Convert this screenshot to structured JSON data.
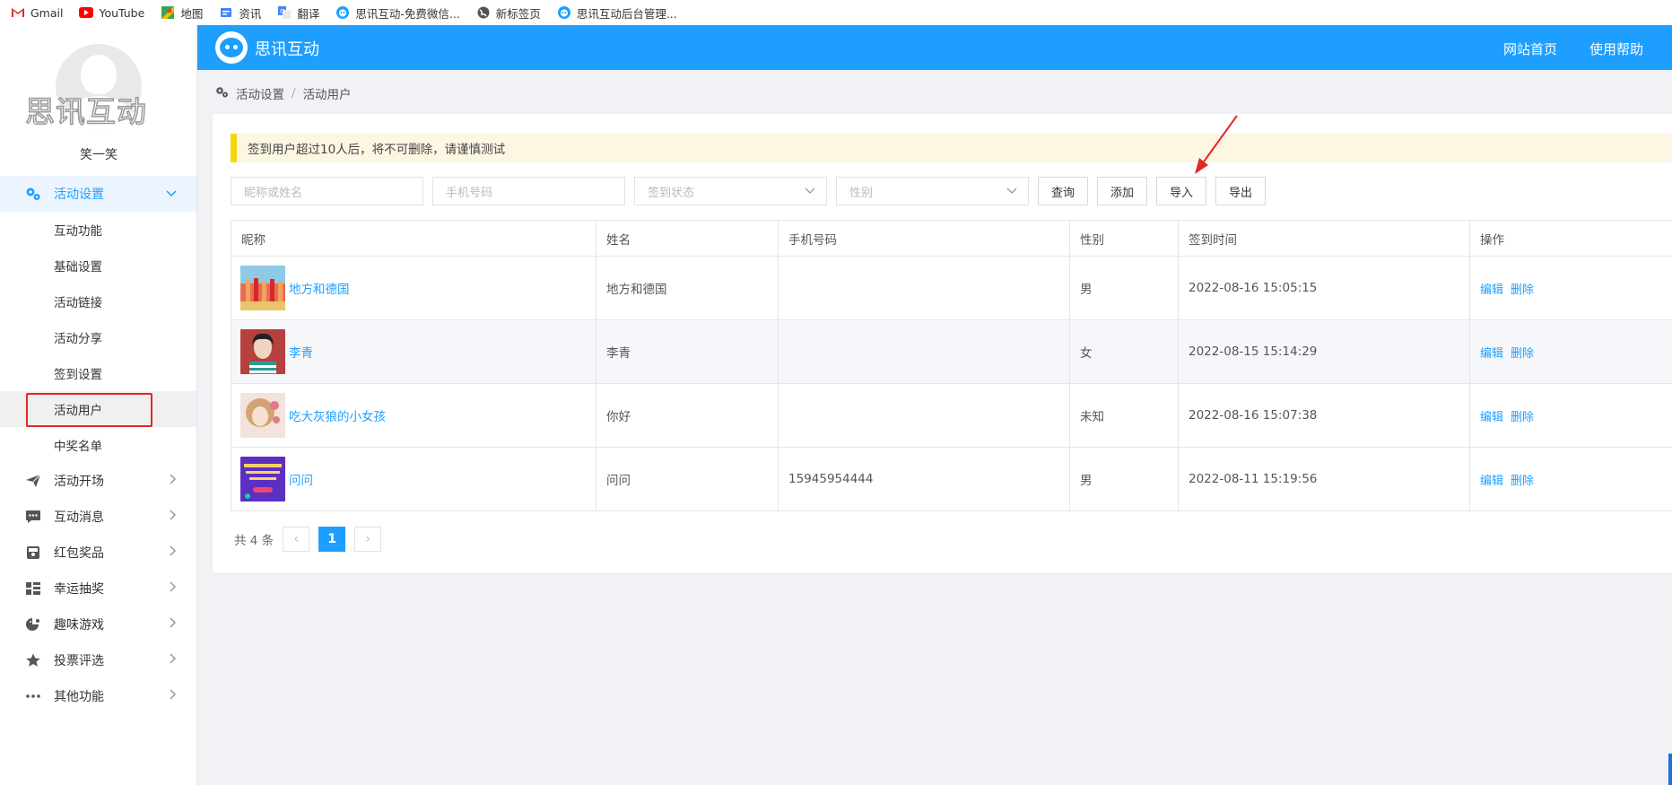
{
  "bookmarks": [
    {
      "label": "Gmail",
      "icon": "gmail-icon",
      "color": "#d93025"
    },
    {
      "label": "YouTube",
      "icon": "youtube-icon",
      "color": "#ff0000"
    },
    {
      "label": "地图",
      "icon": "maps-icon",
      "color": "#34a853"
    },
    {
      "label": "资讯",
      "icon": "news-icon",
      "color": "#4285f4"
    },
    {
      "label": "翻译",
      "icon": "translate-icon",
      "color": "#4285f4"
    },
    {
      "label": "思讯互动-免费微信...",
      "icon": "sixun-icon",
      "color": "#1e9fff"
    },
    {
      "label": "新标签页",
      "icon": "globe-icon",
      "color": "#555555"
    },
    {
      "label": "思讯互动后台管理...",
      "icon": "sixun-icon",
      "color": "#1e9fff"
    }
  ],
  "sidebar": {
    "avatar_watermark": "思讯互动",
    "username": "笑一笑",
    "menu_open": {
      "label": "活动设置",
      "icon": "gear-icon"
    },
    "sub_items": [
      "互动功能",
      "基础设置",
      "活动链接",
      "活动分享",
      "签到设置",
      "活动用户",
      "中奖名单"
    ],
    "menu_rest": [
      {
        "label": "活动开场",
        "icon": "paper-plane-icon"
      },
      {
        "label": "互动消息",
        "icon": "chat-icon"
      },
      {
        "label": "红包奖品",
        "icon": "gift-icon"
      },
      {
        "label": "幸运抽奖",
        "icon": "lottery-icon"
      },
      {
        "label": "趣味游戏",
        "icon": "game-icon"
      },
      {
        "label": "投票评选",
        "icon": "star-icon"
      },
      {
        "label": "其他功能",
        "icon": "more-icon"
      }
    ]
  },
  "header": {
    "brand": "思讯互动",
    "link_home": "网站首页",
    "link_help": "使用帮助",
    "bg_color": "#1e9fff"
  },
  "breadcrumb": {
    "parent": "活动设置",
    "sep": "/",
    "current": "活动用户"
  },
  "notice": "签到用户超过10人后，将不可删除，请谨慎测试",
  "filters": {
    "nick_placeholder": "昵称或姓名",
    "phone_placeholder": "手机号码",
    "status_placeholder": "签到状态",
    "gender_placeholder": "性别",
    "btn_query": "查询",
    "btn_add": "添加",
    "btn_import": "导入",
    "btn_export": "导出"
  },
  "table": {
    "headers": [
      "昵称",
      "姓名",
      "手机号码",
      "性别",
      "签到时间",
      "操作"
    ],
    "rows": [
      {
        "nickname": "地方和德国",
        "name": "地方和德国",
        "phone": "",
        "gender": "男",
        "time": "2022-08-16 15:05:15",
        "edit": "编辑",
        "delete": "删除"
      },
      {
        "nickname": "李青",
        "name": "李青",
        "phone": "",
        "gender": "女",
        "time": "2022-08-15 15:14:29",
        "edit": "编辑",
        "delete": "删除"
      },
      {
        "nickname": "吃大灰狼的小女孩",
        "name": "你好",
        "phone": "",
        "gender": "未知",
        "time": "2022-08-16 15:07:38",
        "edit": "编辑",
        "delete": "删除"
      },
      {
        "nickname": "问问",
        "name": "问问",
        "phone": "15945954444",
        "gender": "男",
        "time": "2022-08-11 15:19:56",
        "edit": "编辑",
        "delete": "删除"
      }
    ]
  },
  "pager": {
    "total": "共 4 条",
    "prev": "‹",
    "current": "1",
    "next": "›"
  },
  "colors": {
    "accent": "#1e9fff",
    "annotation_red": "#e32727",
    "notice_bar": "#f5d60a"
  }
}
